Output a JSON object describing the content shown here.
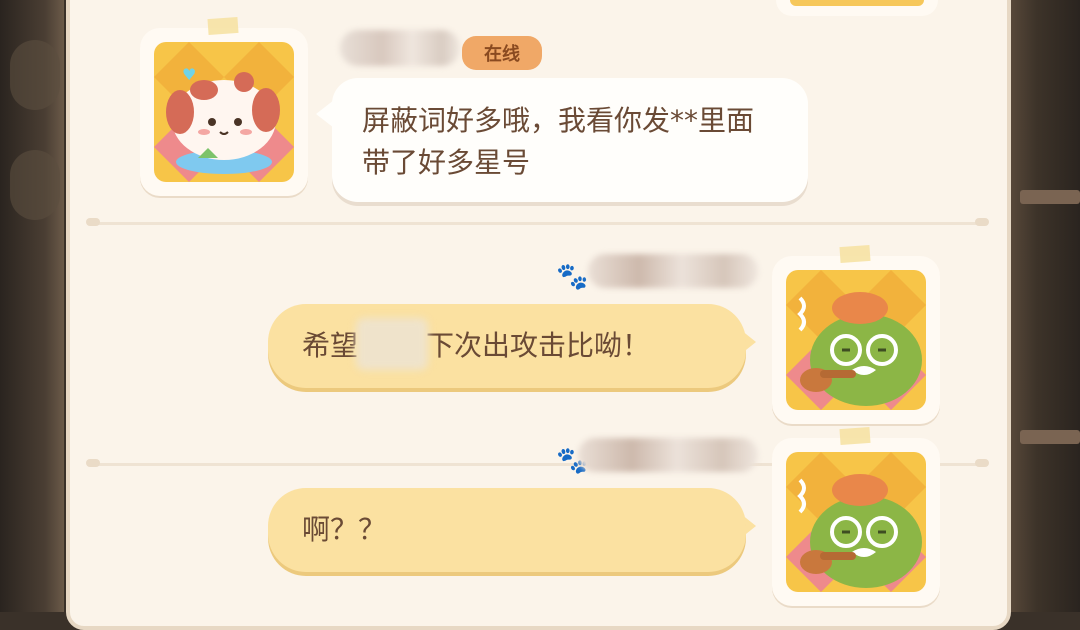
{
  "chat": {
    "messages": [
      {
        "side": "left",
        "sender_status": "在线",
        "avatar": "cream-puppy-avatar",
        "lines": [
          "屏蔽词好多哦，我看你发**里面",
          "带了好多星号"
        ]
      },
      {
        "side": "right",
        "avatar": "green-frog-pipe-avatar",
        "text_before_censor": "希望",
        "text_after_censor": "下次出攻击比呦！"
      },
      {
        "side": "right",
        "avatar": "green-frog-pipe-avatar",
        "text": "啊？？"
      }
    ]
  },
  "colors": {
    "panel_bg": "#fbf4ea",
    "left_bubble": "#fffefb",
    "right_bubble": "#fbe1a1",
    "online_badge": "#f0a867",
    "text": "#6a4a35"
  }
}
